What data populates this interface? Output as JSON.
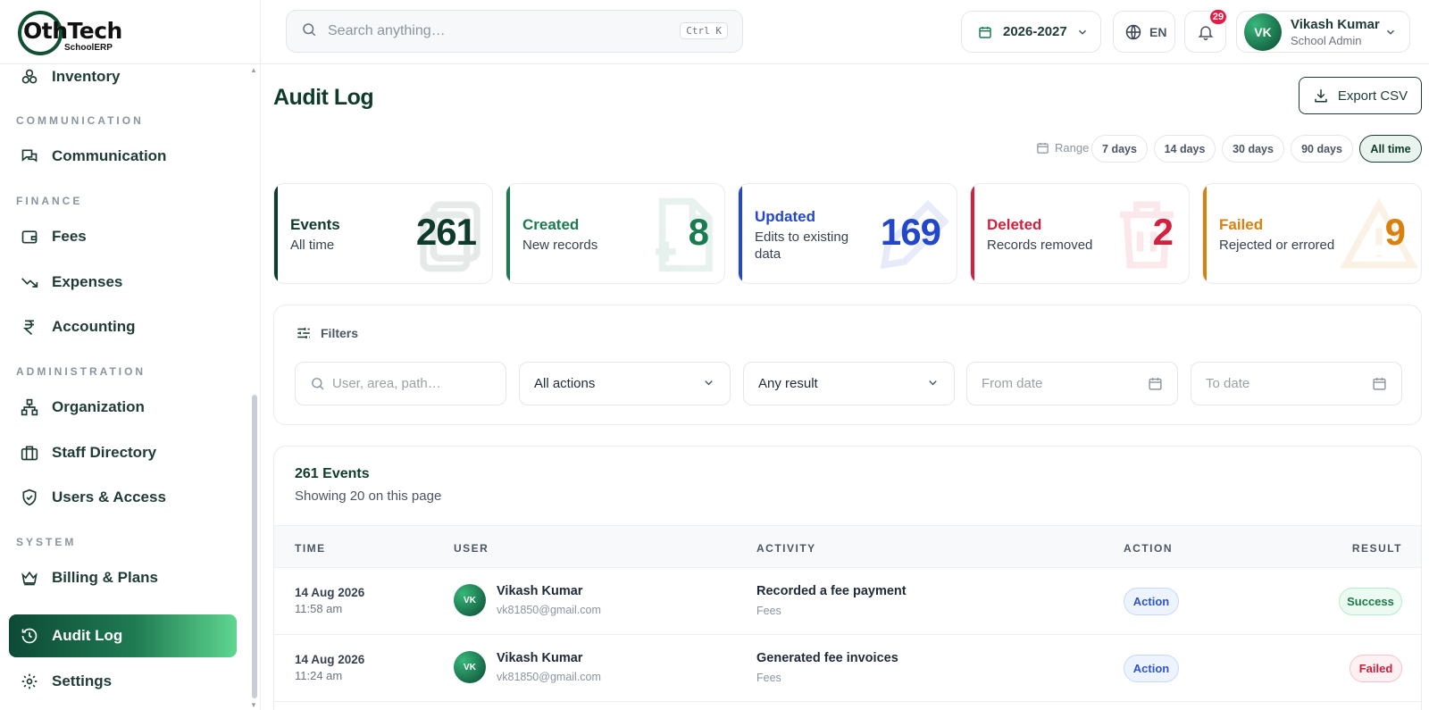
{
  "brand": {
    "name": "OthTech",
    "sub": "SchoolERP"
  },
  "sidebar": {
    "items": [
      {
        "label": "Inventory",
        "icon": "boxes-icon"
      },
      {
        "label": "Communication",
        "icon": "chat-icon"
      },
      {
        "label": "Fees",
        "icon": "wallet-icon"
      },
      {
        "label": "Expenses",
        "icon": "trend-down-icon"
      },
      {
        "label": "Accounting",
        "icon": "rupee-icon"
      },
      {
        "label": "Organization",
        "icon": "org-chart-icon"
      },
      {
        "label": "Staff Directory",
        "icon": "briefcase-icon"
      },
      {
        "label": "Users & Access",
        "icon": "shield-icon"
      },
      {
        "label": "Billing & Plans",
        "icon": "crown-icon"
      },
      {
        "label": "Audit Log",
        "icon": "history-icon"
      },
      {
        "label": "Settings",
        "icon": "gear-icon"
      }
    ],
    "sections": [
      "COMMUNICATION",
      "FINANCE",
      "ADMINISTRATION",
      "SYSTEM"
    ]
  },
  "topbar": {
    "search_placeholder": "Search anything…",
    "shortcut": "Ctrl K",
    "year": "2026-2027",
    "lang": "EN",
    "notifications": "29",
    "user": {
      "initials": "VK",
      "name": "Vikash Kumar",
      "role": "School Admin"
    }
  },
  "page": {
    "title": "Audit Log",
    "export_label": "Export CSV",
    "range_label": "Range",
    "ranges": [
      "7 days",
      "14 days",
      "30 days",
      "90 days",
      "All time"
    ],
    "active_range": "All time"
  },
  "stats": [
    {
      "title": "Events",
      "sub": "All time",
      "value": "261",
      "color": "#0e3b2c"
    },
    {
      "title": "Created",
      "sub": "New records",
      "value": "8",
      "color": "#1a7a50"
    },
    {
      "title": "Updated",
      "sub": "Edits to existing data",
      "value": "169",
      "color": "#2347c9"
    },
    {
      "title": "Deleted",
      "sub": "Records removed",
      "value": "2",
      "color": "#d0213f"
    },
    {
      "title": "Failed",
      "sub": "Rejected or errored",
      "value": "9",
      "color": "#d9800f"
    }
  ],
  "filters": {
    "heading": "Filters",
    "search_placeholder": "User, area, path…",
    "action": "All actions",
    "result": "Any result",
    "from_placeholder": "From date",
    "to_placeholder": "To date"
  },
  "events": {
    "title": "261 Events",
    "sub": "Showing 20 on this page",
    "columns": [
      "TIME",
      "USER",
      "ACTIVITY",
      "ACTION",
      "RESULT"
    ],
    "rows": [
      {
        "date": "14 Aug 2026",
        "time": "11:58 am",
        "initials": "VK",
        "name": "Vikash Kumar",
        "email": "vk81850@gmail.com",
        "activity": "Recorded a fee payment",
        "area": "Fees",
        "action": "Action",
        "result": "Success"
      },
      {
        "date": "14 Aug 2026",
        "time": "11:24 am",
        "initials": "VK",
        "name": "Vikash Kumar",
        "email": "vk81850@gmail.com",
        "activity": "Generated fee invoices",
        "area": "Fees",
        "action": "Action",
        "result": "Failed"
      }
    ]
  }
}
